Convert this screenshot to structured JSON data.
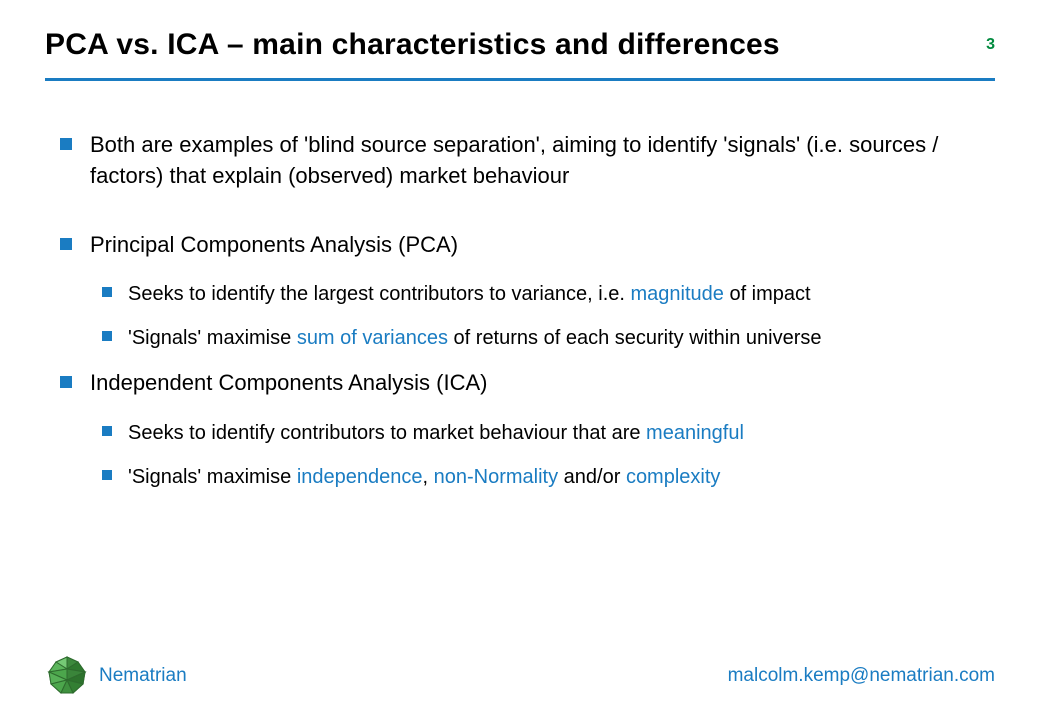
{
  "header": {
    "title": "PCA vs. ICA – main characteristics and differences",
    "page_number": "3"
  },
  "content": {
    "items": [
      {
        "text": "Both are examples of 'blind source separation', aiming to identify 'signals' (i.e. sources / factors) that explain (observed) market behaviour"
      },
      {
        "text": "Principal Components Analysis (PCA)",
        "sub": [
          {
            "pre": "Seeks to identify the largest contributors to variance, i.e. ",
            "hl1": "magnitude",
            "post1": " of impact"
          },
          {
            "pre": "'Signals' maximise ",
            "hl1": "sum of variances",
            "post1": " of returns of each security within universe"
          }
        ]
      },
      {
        "text": "Independent Components Analysis (ICA)",
        "sub": [
          {
            "pre": "Seeks to identify contributors to market behaviour that are ",
            "hl1": "meaningful",
            "post1": ""
          },
          {
            "pre": "'Signals' maximise ",
            "hl1": "independence",
            "mid1": ", ",
            "hl2": "non-Normality",
            "mid2": " and/or ",
            "hl3": "complexity",
            "post1": ""
          }
        ]
      }
    ]
  },
  "footer": {
    "brand": "Nematrian",
    "email": "malcolm.kemp@nematrian.com"
  },
  "colors": {
    "accent": "#1a7cc2",
    "page_number": "#008a3e"
  }
}
